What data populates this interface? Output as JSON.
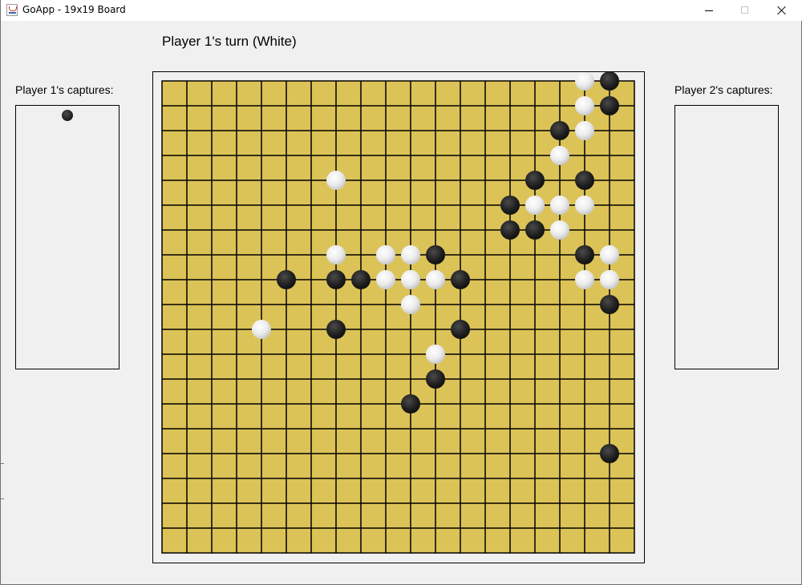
{
  "window": {
    "title": "GoApp - 19x19 Board",
    "icon": "java-cup-icon",
    "controls": [
      "minimize-icon",
      "maximize-icon",
      "close-icon"
    ]
  },
  "status": {
    "turn_text": "Player 1's turn (White)"
  },
  "captures": {
    "player1_label": "Player 1's captures:",
    "player2_label": "Player 2's captures:",
    "player1_stones": [
      {
        "color": "black"
      }
    ],
    "player2_stones": []
  },
  "board": {
    "size": 19,
    "board_color": "#dcc357",
    "line_color": "#000000",
    "stones": [
      {
        "col": 18,
        "row": 0,
        "color": "black"
      },
      {
        "col": 18,
        "row": 1,
        "color": "black"
      },
      {
        "col": 17,
        "row": 0,
        "color": "white"
      },
      {
        "col": 17,
        "row": 1,
        "color": "white"
      },
      {
        "col": 17,
        "row": 2,
        "color": "white"
      },
      {
        "col": 16,
        "row": 2,
        "color": "black"
      },
      {
        "col": 16,
        "row": 3,
        "color": "white"
      },
      {
        "col": 15,
        "row": 4,
        "color": "black"
      },
      {
        "col": 17,
        "row": 4,
        "color": "black"
      },
      {
        "col": 14,
        "row": 5,
        "color": "black"
      },
      {
        "col": 15,
        "row": 5,
        "color": "white"
      },
      {
        "col": 16,
        "row": 5,
        "color": "white"
      },
      {
        "col": 17,
        "row": 5,
        "color": "white"
      },
      {
        "col": 14,
        "row": 6,
        "color": "black"
      },
      {
        "col": 15,
        "row": 6,
        "color": "black"
      },
      {
        "col": 16,
        "row": 6,
        "color": "white"
      },
      {
        "col": 17,
        "row": 7,
        "color": "black"
      },
      {
        "col": 18,
        "row": 7,
        "color": "white"
      },
      {
        "col": 17,
        "row": 8,
        "color": "white"
      },
      {
        "col": 18,
        "row": 8,
        "color": "white"
      },
      {
        "col": 18,
        "row": 9,
        "color": "black"
      },
      {
        "col": 7,
        "row": 4,
        "color": "white"
      },
      {
        "col": 7,
        "row": 7,
        "color": "white"
      },
      {
        "col": 9,
        "row": 7,
        "color": "white"
      },
      {
        "col": 10,
        "row": 7,
        "color": "white"
      },
      {
        "col": 11,
        "row": 7,
        "color": "black"
      },
      {
        "col": 5,
        "row": 8,
        "color": "black"
      },
      {
        "col": 7,
        "row": 8,
        "color": "black"
      },
      {
        "col": 8,
        "row": 8,
        "color": "black"
      },
      {
        "col": 9,
        "row": 8,
        "color": "white"
      },
      {
        "col": 10,
        "row": 8,
        "color": "white"
      },
      {
        "col": 11,
        "row": 8,
        "color": "white"
      },
      {
        "col": 12,
        "row": 8,
        "color": "black"
      },
      {
        "col": 10,
        "row": 9,
        "color": "white"
      },
      {
        "col": 4,
        "row": 10,
        "color": "white"
      },
      {
        "col": 7,
        "row": 10,
        "color": "black"
      },
      {
        "col": 12,
        "row": 10,
        "color": "black"
      },
      {
        "col": 11,
        "row": 11,
        "color": "white"
      },
      {
        "col": 11,
        "row": 12,
        "color": "black"
      },
      {
        "col": 10,
        "row": 13,
        "color": "black"
      },
      {
        "col": 18,
        "row": 15,
        "color": "black"
      }
    ]
  }
}
